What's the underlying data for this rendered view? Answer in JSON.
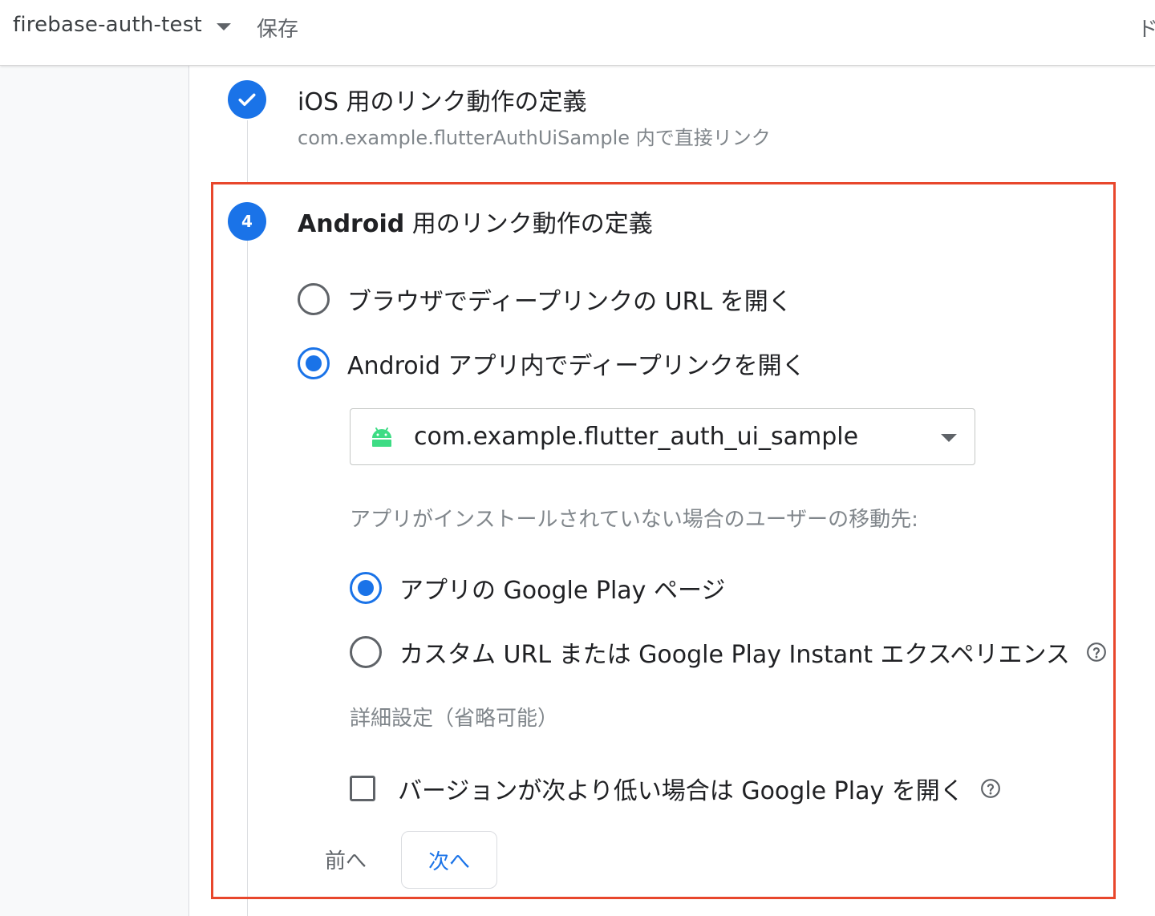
{
  "header": {
    "project_name": "firebase-auth-test",
    "save_label": "保存",
    "right_truncated": "ド"
  },
  "steps": {
    "ios": {
      "title": "iOS 用のリンク動作の定義",
      "subtitle": "com.example.flutterAuthUiSample 内で直接リンク"
    },
    "android": {
      "number": "4",
      "title_prefix": "Android",
      "title_rest": " 用のリンク動作の定義",
      "options": [
        {
          "label": "ブラウザでディープリンクの URL を開く",
          "selected": false
        },
        {
          "label": "Android アプリ内でディープリンクを開く",
          "selected": true
        }
      ],
      "app_select": {
        "value": "com.example.flutter_auth_ui_sample"
      },
      "not_installed_label": "アプリがインストールされていない場合のユーザーの移動先:",
      "fallback_options": [
        {
          "label": "アプリの Google Play ページ",
          "selected": true
        },
        {
          "label": "カスタム URL または Google Play Instant エクスペリエンス",
          "selected": false
        }
      ],
      "advanced_label": "詳細設定（省略可能）",
      "min_version_checkbox": {
        "label": "バージョンが次より低い場合は Google Play を開く",
        "checked": false
      },
      "prev_label": "前へ",
      "next_label": "次へ"
    }
  },
  "colors": {
    "accent": "#1a73e8",
    "highlight_border": "#e8472c",
    "android_green": "#3ddc84"
  },
  "icons": {
    "project_dropdown": "chevron-down-icon",
    "step_done": "check-icon",
    "app_platform": "android-icon",
    "select_dropdown": "caret-down-icon",
    "help": "help-circle-icon"
  }
}
